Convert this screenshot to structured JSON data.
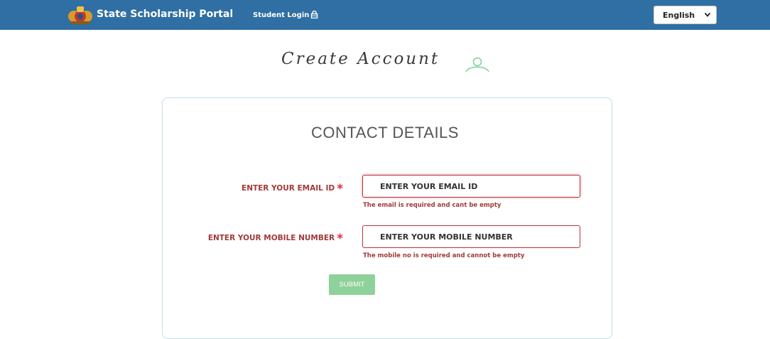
{
  "header": {
    "brand": "State Scholarship Portal",
    "student_login": "Student Login",
    "language": "English",
    "icons": {
      "logo": "emblem-logo",
      "login": "lock-icon",
      "language": "chevron-down-icon"
    }
  },
  "page": {
    "title": "Create Account",
    "title_icon": "user-icon"
  },
  "form": {
    "section_title": "CONTACT DETAILS",
    "email": {
      "label": "ENTER YOUR EMAIL ID",
      "placeholder": "ENTER YOUR EMAIL ID",
      "value": "",
      "required_marker": "*",
      "error": "The email is required and cant be empty"
    },
    "mobile": {
      "label": "ENTER YOUR MOBILE NUMBER",
      "placeholder": "ENTER YOUR MOBILE NUMBER",
      "value": "",
      "required_marker": "*",
      "error": "The mobile no is required and cannot be empty"
    },
    "submit_label": "SUBMIT"
  },
  "colors": {
    "navbar": "#2f6fa3",
    "error": "#a23a3a",
    "required": "#d9303a",
    "submit": "#8fd19a",
    "card_border": "#bfe0e6"
  }
}
